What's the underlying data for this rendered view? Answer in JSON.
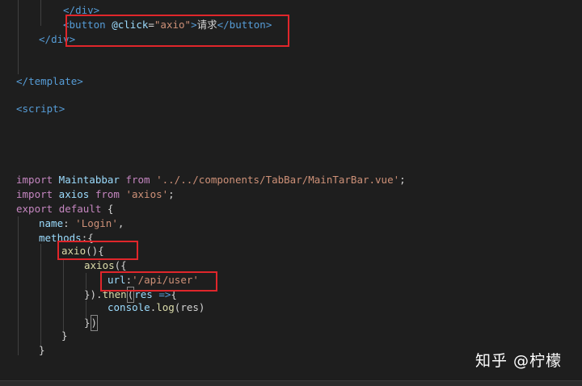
{
  "code": {
    "l1": {
      "close": "</",
      "tag": "div",
      "end": ">"
    },
    "l2": {
      "open": "<",
      "tag": "button",
      "attr": " @click",
      "eq": "=",
      "val": "\"axio\"",
      "gt": ">",
      "text": "请求",
      "close": "</",
      "tag2": "button",
      "end": ">"
    },
    "l3": {
      "close": "</",
      "tag": "div",
      "end": ">"
    },
    "l4": {
      "close": "</",
      "tag": "template",
      "end": ">"
    },
    "l5": {
      "open": "<",
      "tag": "script",
      "end": ">"
    },
    "l6": {
      "kw": "import",
      "name": " Maintabbar ",
      "kw2": "from",
      "sp": " ",
      "str": "'../../components/TabBar/MainTarBar.vue'",
      "semi": ";"
    },
    "l7": {
      "kw": "import",
      "name": " axios ",
      "kw2": "from",
      "sp": " ",
      "str": "'axios'",
      "semi": ";"
    },
    "l8": {
      "kw": "export",
      "sp": " ",
      "kw2": "default",
      "rest": " {"
    },
    "l9": {
      "key": "name",
      "colon": ": ",
      "str": "'Login'",
      "comma": ","
    },
    "l10": {
      "key": "methods",
      "rest": ":{"
    },
    "l11": {
      "fn": "axio",
      "rest": "(){"
    },
    "l12": {
      "fn": "axios",
      "rest": "({"
    },
    "l13": {
      "key": "url",
      "colon": ":",
      "str": "'/api/user'"
    },
    "l14": {
      "pre": "}).",
      "fn": "then",
      "paren": "(",
      "var": "res",
      "arrow": " =>",
      "rest": "{"
    },
    "l15": {
      "obj": "console",
      "dot": ".",
      "fn": "log",
      "rest": "(res)"
    },
    "l16": {
      "brace": "}",
      "paren": ")"
    },
    "l17": {
      "brace": "}"
    },
    "l18": {
      "brace": "}"
    }
  },
  "watermark": "知乎 @柠檬",
  "colors": {
    "background": "#1e1e1e",
    "highlight_box": "#e0262b",
    "tag": "#569cd6",
    "attribute": "#9cdcfe",
    "string": "#ce9178",
    "keyword": "#c586c0",
    "function": "#dcdcaa"
  }
}
